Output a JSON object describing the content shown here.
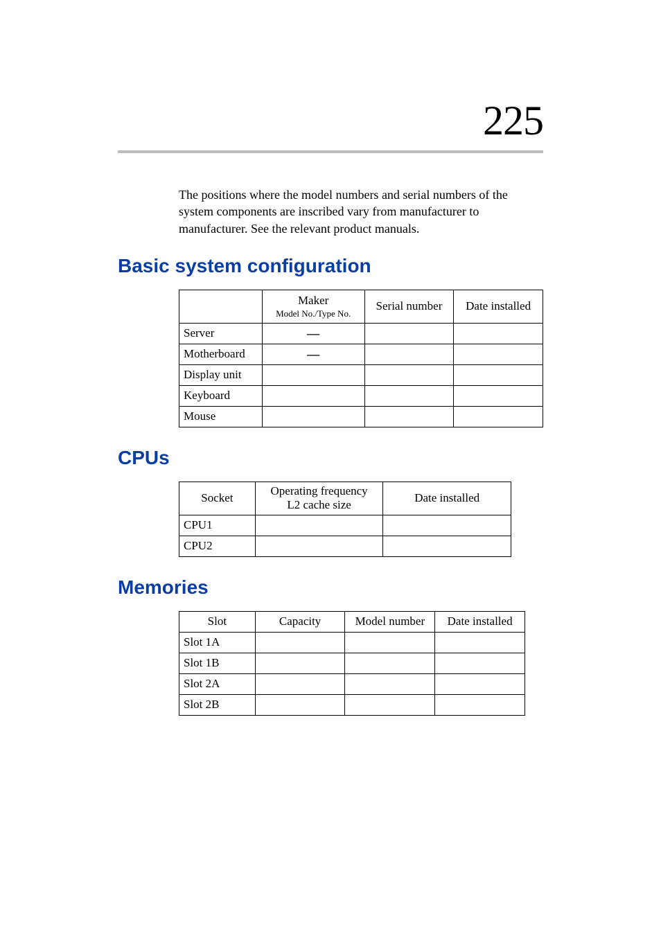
{
  "page_number": "225",
  "intro_text": "The positions where the model numbers and serial numbers of the system components are inscribed vary from manufacturer to manufacturer.  See the relevant product manuals.",
  "sections": {
    "basic": {
      "heading": "Basic system configuration",
      "header": {
        "blank": "",
        "maker_line1": "Maker",
        "maker_line2": "Model No./Type No.",
        "serial": "Serial number",
        "date": "Date installed"
      },
      "rows": [
        {
          "label": "Server",
          "maker": "—",
          "serial": "",
          "date": ""
        },
        {
          "label": "Motherboard",
          "maker": "—",
          "serial": "",
          "date": ""
        },
        {
          "label": "Display unit",
          "maker": "",
          "serial": "",
          "date": ""
        },
        {
          "label": "Keyboard",
          "maker": "",
          "serial": "",
          "date": ""
        },
        {
          "label": "Mouse",
          "maker": "",
          "serial": "",
          "date": ""
        }
      ]
    },
    "cpus": {
      "heading": "CPUs",
      "header": {
        "socket": "Socket",
        "freq_line1": "Operating frequency",
        "freq_line2": "L2 cache size",
        "date": "Date installed"
      },
      "rows": [
        {
          "label": "CPU1",
          "freq": "",
          "date": ""
        },
        {
          "label": "CPU2",
          "freq": "",
          "date": ""
        }
      ]
    },
    "memories": {
      "heading": "Memories",
      "header": {
        "slot": "Slot",
        "capacity": "Capacity",
        "model": "Model number",
        "date": "Date installed"
      },
      "rows": [
        {
          "label": "Slot 1A",
          "capacity": "",
          "model": "",
          "date": ""
        },
        {
          "label": "Slot 1B",
          "capacity": "",
          "model": "",
          "date": ""
        },
        {
          "label": "Slot 2A",
          "capacity": "",
          "model": "",
          "date": ""
        },
        {
          "label": "Slot 2B",
          "capacity": "",
          "model": "",
          "date": ""
        }
      ]
    }
  }
}
